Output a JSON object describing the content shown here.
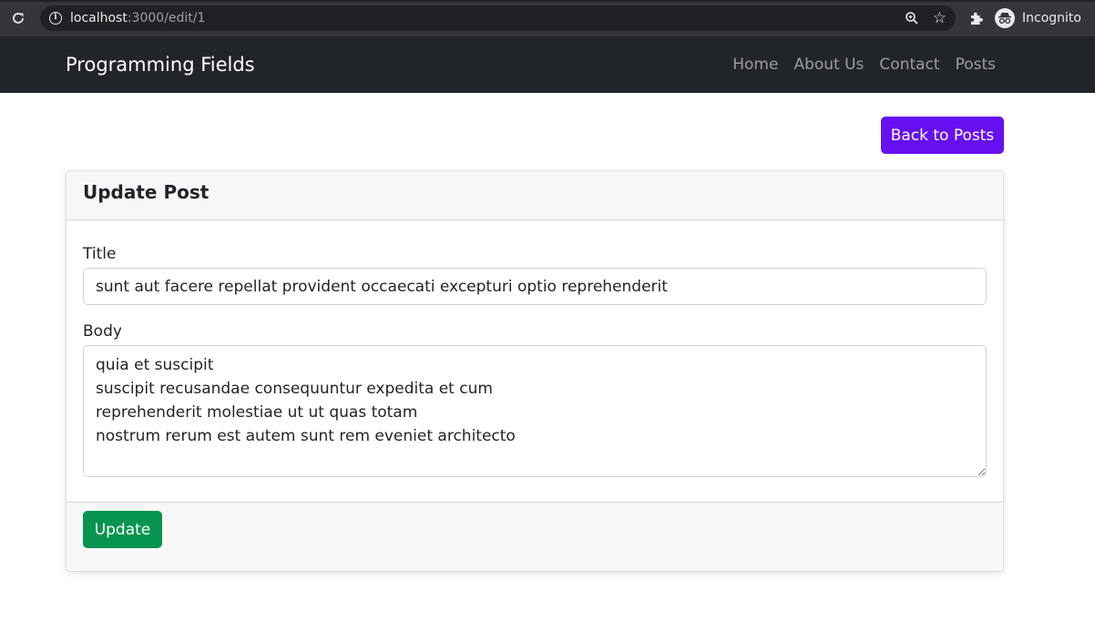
{
  "browser": {
    "url_host": "localhost",
    "url_rest": ":3000/edit/1",
    "profile_label": "Incognito",
    "icons": [
      "reload-icon",
      "site-info-icon",
      "zoom-icon",
      "bookmark-star-icon",
      "extensions-icon",
      "incognito-icon"
    ]
  },
  "navbar": {
    "brand": "Programming Fields",
    "links": [
      {
        "label": "Home"
      },
      {
        "label": "About Us"
      },
      {
        "label": "Contact"
      },
      {
        "label": "Posts"
      }
    ]
  },
  "actions": {
    "back_label": "Back to Posts"
  },
  "card": {
    "title": "Update Post",
    "title_field_label": "Title",
    "title_value": "sunt aut facere repellat provident occaecati excepturi optio reprehenderit",
    "body_field_label": "Body",
    "body_value": "quia et suscipit\nsuscipit recusandae consequuntur expedita et cum\nreprehenderit molestiae ut ut quas totam\nnostrum rerum est autem sunt rem eveniet architecto",
    "submit_label": "Update"
  },
  "colors": {
    "navbar_bg": "#212529",
    "back_button": "#6610f2",
    "update_button": "#079451"
  }
}
